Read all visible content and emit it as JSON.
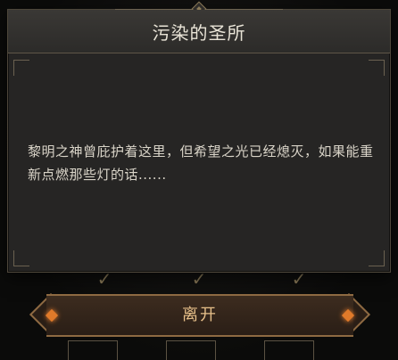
{
  "dialog": {
    "title": "污染的圣所",
    "message": "黎明之神曾庇护着这里，但希望之光已经熄灭，如果能重新点燃那些灯的话......"
  },
  "button": {
    "leave_label": "离开"
  },
  "colors": {
    "panel": "#262524",
    "title_bar": "#3a3835",
    "button_text": "#e7c08a",
    "gem": "#e07a2a"
  },
  "background": {
    "checkmarks": [
      "✓",
      "✓",
      "✓"
    ]
  }
}
